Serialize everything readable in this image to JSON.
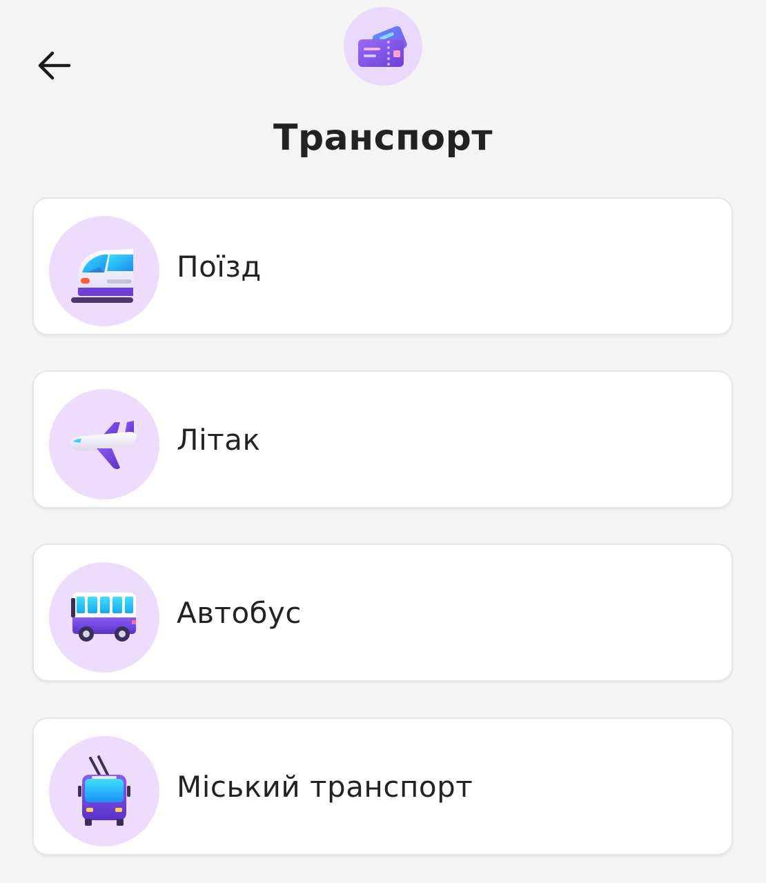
{
  "header": {
    "back_icon": "arrow-left-icon",
    "category_icon": "tickets-icon",
    "title": "Транспорт"
  },
  "items": [
    {
      "label": "Поїзд",
      "icon": "train-icon"
    },
    {
      "label": "Літак",
      "icon": "airplane-icon"
    },
    {
      "label": "Автобус",
      "icon": "bus-icon"
    },
    {
      "label": "Міський транспорт",
      "icon": "trolleybus-icon"
    }
  ],
  "colors": {
    "background": "#f4f4f4",
    "icon_circle": "#eedcfc",
    "accent_purple": "#6d3fd8",
    "text": "#222222"
  }
}
